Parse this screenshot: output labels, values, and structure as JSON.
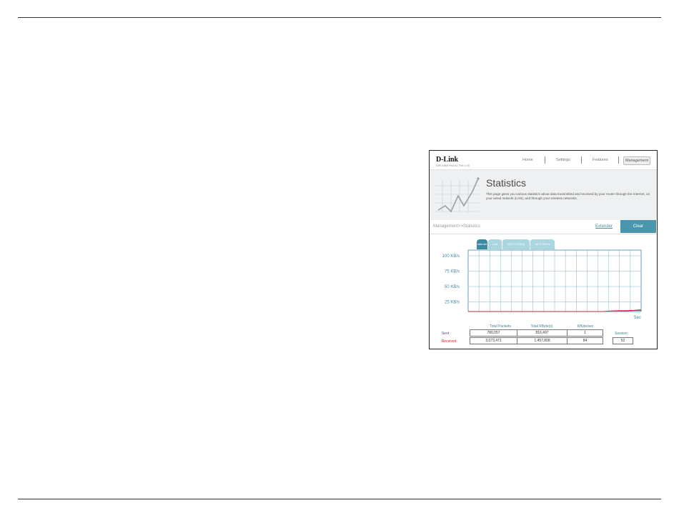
{
  "header": {
    "logo": "D-Link",
    "model": "DIR-1960 HW:A1 FW:1.00",
    "nav": [
      "Home",
      "Settings",
      "Features",
      "Management"
    ],
    "active_nav": "Management"
  },
  "banner": {
    "title": "Statistics",
    "description": "This page gives you various statistics about data transmitted and received by your router through the Internet, on your wired network (LAN), and through your wireless networks."
  },
  "breadcrumb": "Management>>Statistics",
  "actions": {
    "extender": "Extender",
    "clear": "Clear"
  },
  "tabs": [
    "Internet",
    "LAN",
    "Wi-Fi 2.4GHz",
    "Wi-Fi 5GHz"
  ],
  "active_tab": "Internet",
  "chart_data": {
    "type": "line",
    "y_tick_labels": [
      "100 KB/s",
      "75 KB/s",
      "50 KB/s",
      "25 KB/s"
    ],
    "x_unit_label": "Sec",
    "ylim": [
      0,
      100
    ],
    "grid": true,
    "series": [
      {
        "color": "#6b2f8f",
        "values": [
          0,
          0,
          0,
          0,
          0,
          0,
          0,
          0,
          0,
          0,
          0,
          0,
          0,
          0,
          0,
          0,
          0,
          0,
          0,
          1,
          1,
          1,
          1.5,
          2
        ]
      },
      {
        "color": "#d9222a",
        "values": [
          0,
          0,
          0,
          0,
          0,
          0,
          0,
          0,
          0,
          0,
          0,
          0,
          0,
          0,
          0,
          0,
          0,
          0,
          0,
          1,
          1.5,
          1.5,
          2,
          3
        ]
      }
    ]
  },
  "stats": {
    "columns": [
      "Total Packets",
      "Total KByte(s)",
      "KByte/sec"
    ],
    "rows": [
      {
        "label": "Sent",
        "color": "#3f4aa1",
        "values": [
          "780,057",
          "816,497",
          "1"
        ]
      },
      {
        "label": "Received",
        "color": "#d9222a",
        "values": [
          "3,073,471",
          "1,457,808",
          "84"
        ]
      }
    ],
    "session_label": "Session",
    "session_value": "52"
  }
}
